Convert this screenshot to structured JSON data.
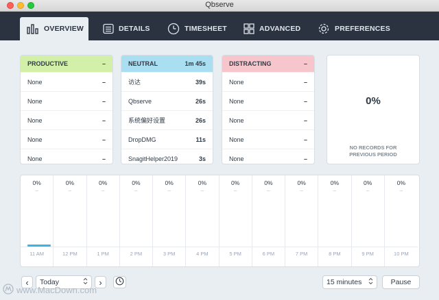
{
  "window": {
    "title": "Qbserve"
  },
  "tabs": [
    {
      "label": "OVERVIEW",
      "icon": "bar-chart-icon",
      "active": true
    },
    {
      "label": "DETAILS",
      "icon": "list-icon",
      "active": false
    },
    {
      "label": "TIMESHEET",
      "icon": "clock-icon",
      "active": false
    },
    {
      "label": "ADVANCED",
      "icon": "grid-icon",
      "active": false
    },
    {
      "label": "PREFERENCES",
      "icon": "gear-icon",
      "active": false
    }
  ],
  "cards": {
    "productive": {
      "label": "PRODUCTIVE",
      "total": "–",
      "color": "#d3f0a8",
      "rows": [
        {
          "name": "None",
          "value": "–"
        },
        {
          "name": "None",
          "value": "–"
        },
        {
          "name": "None",
          "value": "–"
        },
        {
          "name": "None",
          "value": "–"
        },
        {
          "name": "None",
          "value": "–"
        }
      ]
    },
    "neutral": {
      "label": "NEUTRAL",
      "total": "1m 45s",
      "color": "#a9dff0",
      "rows": [
        {
          "name": "访达",
          "value": "39s"
        },
        {
          "name": "Qbserve",
          "value": "26s"
        },
        {
          "name": "系统偏好设置",
          "value": "26s"
        },
        {
          "name": "DropDMG",
          "value": "11s"
        },
        {
          "name": "SnagitHelper2019",
          "value": "3s"
        }
      ]
    },
    "distracting": {
      "label": "DISTRACTING",
      "total": "–",
      "color": "#f6c6cc",
      "rows": [
        {
          "name": "None",
          "value": "–"
        },
        {
          "name": "None",
          "value": "–"
        },
        {
          "name": "None",
          "value": "–"
        },
        {
          "name": "None",
          "value": "–"
        },
        {
          "name": "None",
          "value": "–"
        }
      ]
    }
  },
  "summary": {
    "percent": "0%",
    "note_line1": "NO RECORDS FOR",
    "note_line2": "PREVIOUS PERIOD"
  },
  "timeline": [
    {
      "hour": "11 AM",
      "percent": "0%",
      "dash": "–",
      "activity": true
    },
    {
      "hour": "12 PM",
      "percent": "0%",
      "dash": "–",
      "activity": false
    },
    {
      "hour": "1 PM",
      "percent": "0%",
      "dash": "–",
      "activity": false
    },
    {
      "hour": "2 PM",
      "percent": "0%",
      "dash": "–",
      "activity": false
    },
    {
      "hour": "3 PM",
      "percent": "0%",
      "dash": "–",
      "activity": false
    },
    {
      "hour": "4 PM",
      "percent": "0%",
      "dash": "–",
      "activity": false
    },
    {
      "hour": "5 PM",
      "percent": "0%",
      "dash": "–",
      "activity": false
    },
    {
      "hour": "6 PM",
      "percent": "0%",
      "dash": "–",
      "activity": false
    },
    {
      "hour": "7 PM",
      "percent": "0%",
      "dash": "–",
      "activity": false
    },
    {
      "hour": "8 PM",
      "percent": "0%",
      "dash": "–",
      "activity": false
    },
    {
      "hour": "9 PM",
      "percent": "0%",
      "dash": "–",
      "activity": false
    },
    {
      "hour": "10 PM",
      "percent": "0%",
      "dash": "–",
      "activity": false
    }
  ],
  "footer": {
    "prev_glyph": "‹",
    "next_glyph": "›",
    "date_value": "Today",
    "interval_value": "15 minutes",
    "pause_label": "Pause",
    "watermark": "www.MacDown.com"
  },
  "colors": {
    "navbar": "#2b3340",
    "accent": "#38b6e0"
  }
}
